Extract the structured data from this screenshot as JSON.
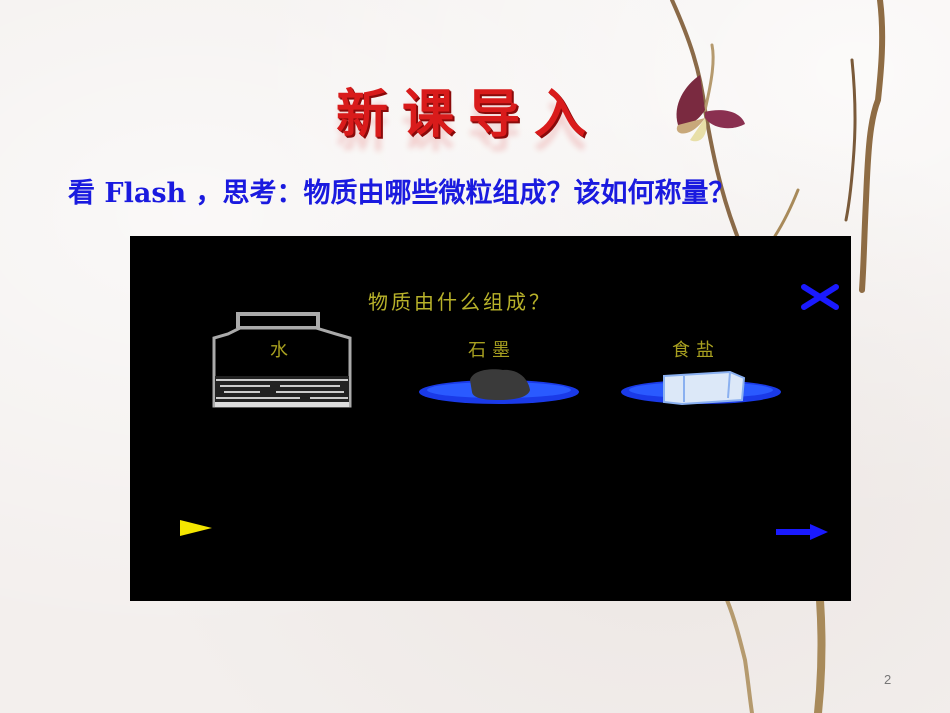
{
  "slide": {
    "title": "新课导入",
    "subtitle": "看 Flash ，思考：物质由哪些微粒组成？该如何称量？",
    "page_number": "2"
  },
  "flash": {
    "question": "物质由什么组成？",
    "items": [
      {
        "label": "水",
        "icon": "water-jar-icon"
      },
      {
        "label": "石墨",
        "icon": "graphite-plate-icon"
      },
      {
        "label": "食盐",
        "icon": "salt-plate-icon"
      }
    ],
    "controls": {
      "close": "close-icon",
      "play": "play-icon",
      "next": "next-arrow-icon"
    },
    "colors": {
      "background": "#000000",
      "text": "#b8b22a",
      "accent_blue": "#1a1adf",
      "play_yellow": "#f5e600"
    }
  },
  "colors": {
    "title_red": "#d91b1b",
    "subtitle_blue": "#1a1adf"
  }
}
